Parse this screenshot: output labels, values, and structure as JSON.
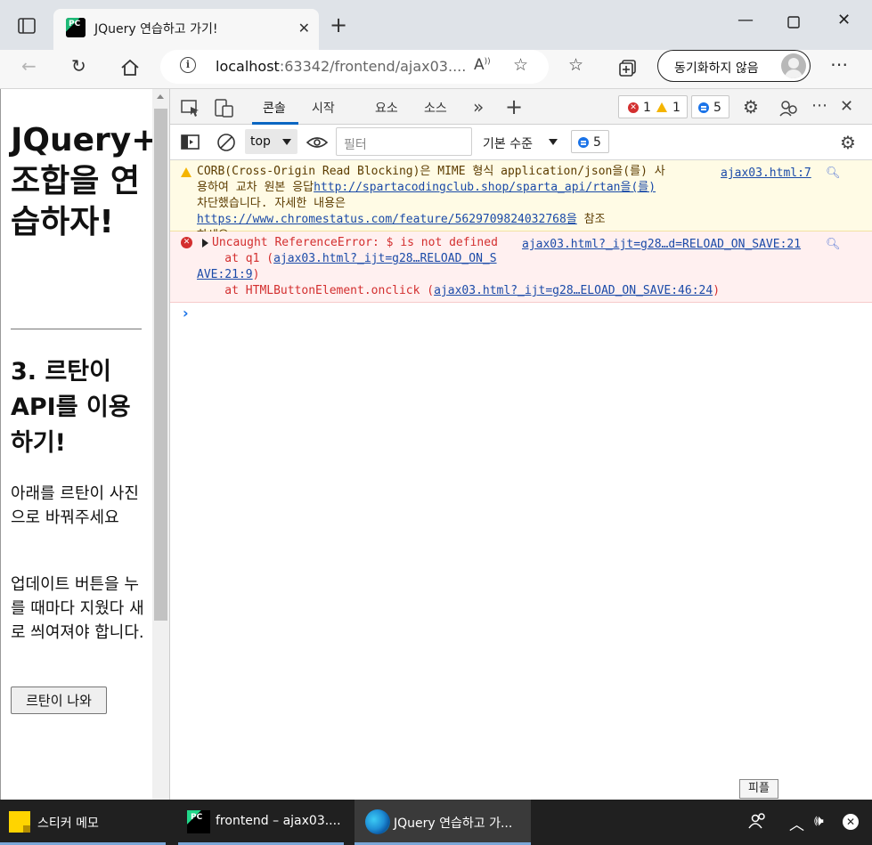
{
  "browser": {
    "tab": {
      "title": "JQuery 연습하고 가기!",
      "favicon_text": "PC"
    },
    "address": {
      "host": "localhost",
      "rest": ":63342/frontend/ajax03....",
      "read_aloud_label": "Ă",
      "sync_label": "동기화하지 않음"
    }
  },
  "page": {
    "title": "JQuery+의 조합을 연습하자!",
    "section_title": "3. 르탄이 API를 이용하기!",
    "paragraph1": "아래를 르탄이 사진으로 바꿔주세요",
    "paragraph2": "업데이트 버튼을 누를 때마다 지웠다 새로 씌여져야 합니다.",
    "button_label": "르탄이 나와"
  },
  "devtools": {
    "tabs": [
      {
        "label": "콘솔",
        "active": true
      },
      {
        "label": "시작",
        "active": false
      },
      {
        "label": "요소",
        "active": false
      },
      {
        "label": "소스",
        "active": false
      }
    ],
    "counts": {
      "errors": "1",
      "warnings": "1",
      "info": "5"
    },
    "context": "top",
    "filter_placeholder": "필터",
    "level_label": "기본 수준",
    "messages": {
      "warning": {
        "line1": "CORB(Cross-Origin Read Blocking)은 MIME 형식 application/json을(를) 사",
        "line2_pre": "용하여 교차 원본 응답",
        "line2_link": "http://spartacodingclub.shop/sparta_api/rtan을(를)",
        "line3_pre": "차단했습니다. 자세한 내용은 ",
        "line3_link": "https://www.chromestatus.com/feature/5629709824032768을",
        "line3_post": " 참조",
        "line4": "하세요.",
        "source": "ajax03.html:7"
      },
      "error": {
        "text": "Uncaught ReferenceError: $ is not defined",
        "source": "ajax03.html?_ijt=g28…d=RELOAD_ON_SAVE:21",
        "stack1_pre": "    at q1 (",
        "stack1_link": "ajax03.html?_ijt=g28…RELOAD_ON_S",
        "stack1_link2": "AVE:21:9",
        "stack1_post": ")",
        "stack2_pre": "    at HTMLButtonElement.onclick (",
        "stack2_link": "ajax03.html?_ijt=g28…ELOAD_ON_SAVE:46:24",
        "stack2_post": ")"
      }
    },
    "tooltip": "피플"
  },
  "taskbar": {
    "items": [
      {
        "label": "스티커 메모"
      },
      {
        "label": "frontend – ajax03....",
        "icon_text": "PC"
      },
      {
        "label": "JQuery 연습하고 가..."
      }
    ]
  },
  "colors": {
    "error": "#d32f2f",
    "warning": "#f4b400",
    "link": "#1a4aa8",
    "accent": "#0a66c2",
    "taskbar": "#202020"
  }
}
